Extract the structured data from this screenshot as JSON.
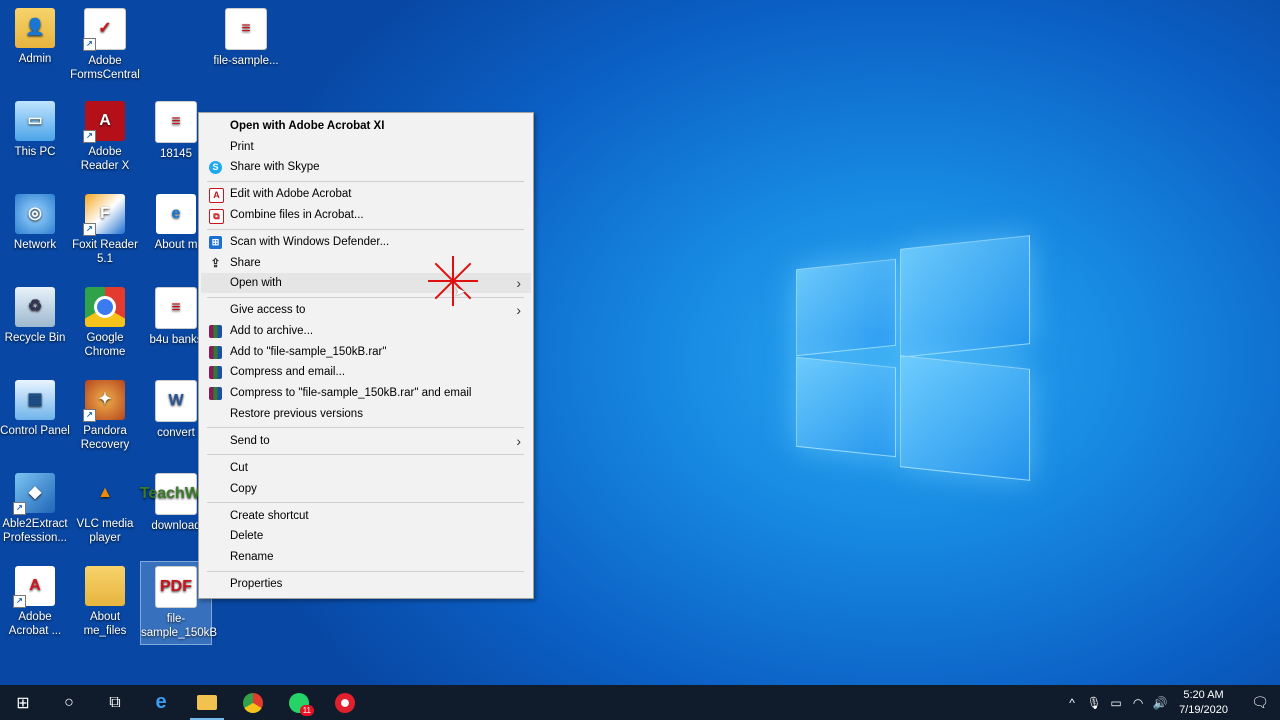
{
  "desktop": {
    "icons": [
      {
        "label": "Admin"
      },
      {
        "label": "Adobe FormsCentral"
      },
      {
        "label": "file-sample..."
      },
      {
        "label": "This PC"
      },
      {
        "label": "Adobe Reader X"
      },
      {
        "label": "18145"
      },
      {
        "label": "Network"
      },
      {
        "label": "Foxit Reader 5.1"
      },
      {
        "label": "About m"
      },
      {
        "label": "Recycle Bin"
      },
      {
        "label": "Google Chrome"
      },
      {
        "label": "b4u banks"
      },
      {
        "label": "Control Panel"
      },
      {
        "label": "Pandora Recovery"
      },
      {
        "label": "convert"
      },
      {
        "label": "Able2Extract Profession..."
      },
      {
        "label": "VLC media player"
      },
      {
        "label": "download"
      },
      {
        "label": "Adobe Acrobat ..."
      },
      {
        "label": "About me_files"
      },
      {
        "label": "file-sample_150kB"
      }
    ],
    "glyphs": {
      "pdf": "PDF",
      "edge": "e",
      "word": "W",
      "vlc": "▲",
      "download": "TeachWiz"
    }
  },
  "context_menu": {
    "items": [
      {
        "label": "Open with Adobe Acrobat XI",
        "bold": true
      },
      {
        "label": "Print"
      },
      {
        "label": "Share with Skype",
        "icon": "skype-icon"
      },
      {
        "label": "Edit with Adobe Acrobat",
        "icon": "acrobat-icon"
      },
      {
        "label": "Combine files in Acrobat...",
        "icon": "acrobat-combine-icon"
      },
      {
        "label": "Scan with Windows Defender...",
        "icon": "defender-icon"
      },
      {
        "label": "Share",
        "icon": "share-icon"
      },
      {
        "label": "Open with",
        "submenu": true
      },
      {
        "label": "Give access to",
        "submenu": true
      },
      {
        "label": "Add to archive...",
        "icon": "winrar-icon"
      },
      {
        "label": "Add to \"file-sample_150kB.rar\"",
        "icon": "winrar-icon"
      },
      {
        "label": "Compress and email...",
        "icon": "winrar-icon"
      },
      {
        "label": "Compress to \"file-sample_150kB.rar\" and email",
        "icon": "winrar-icon"
      },
      {
        "label": "Restore previous versions"
      },
      {
        "label": "Send to",
        "submenu": true
      },
      {
        "label": "Cut"
      },
      {
        "label": "Copy"
      },
      {
        "label": "Create shortcut"
      },
      {
        "label": "Delete"
      },
      {
        "label": "Rename"
      },
      {
        "label": "Properties"
      }
    ],
    "submenu_arrow": "›"
  },
  "taskbar": {
    "start_glyph": "⊞",
    "search_glyph": "○",
    "taskview_glyph": "⧉",
    "whatsapp_badge": "11",
    "clock": {
      "time": "5:20 AM",
      "date": "7/19/2020"
    },
    "tray_glyphs": {
      "chevron": "^",
      "mic": "🎙",
      "battery": "▭",
      "wifi": "◠",
      "volume": "🔊",
      "notification": "🗨"
    }
  },
  "colors": {
    "accent": "#0b73d9",
    "marker": "#e01010",
    "taskbar": "#101c2c"
  }
}
